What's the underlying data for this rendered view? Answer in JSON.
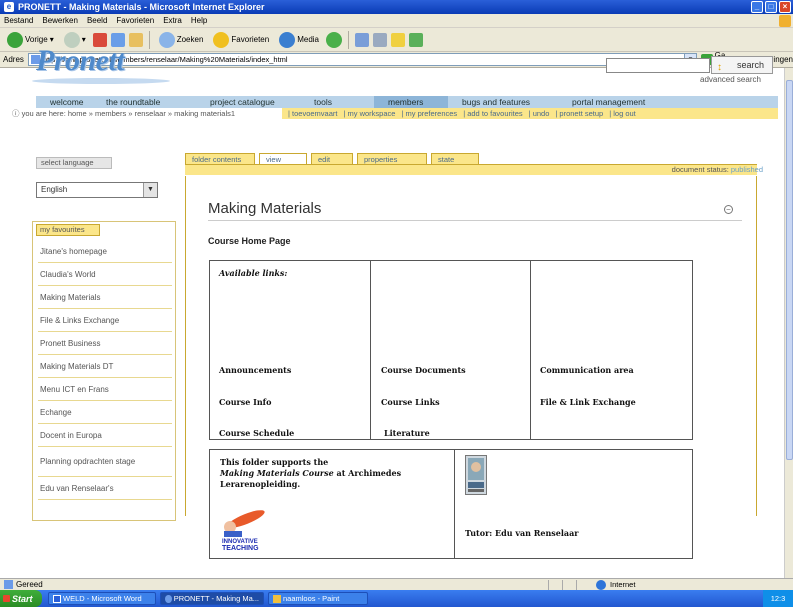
{
  "window": {
    "title": "PRONETT - Making Materials - Microsoft Internet Explorer"
  },
  "menubar": [
    "Bestand",
    "Bewerken",
    "Beeld",
    "Favorieten",
    "Extra",
    "Help"
  ],
  "toolbar": {
    "back": "Vorige",
    "search": "Zoeken",
    "favorites": "Favorieten",
    "media": "Media"
  },
  "address": {
    "label": "Adres",
    "url": "http://www.pronett.nl/Members/renselaar/Making%20Materials/index_html",
    "go": "Ga naar",
    "links": "Koppelingen"
  },
  "site": {
    "logo": "Pronett",
    "search_button": "search",
    "advanced_search": "advanced search"
  },
  "nav": {
    "items": [
      "welcome",
      "the roundtable",
      "project catalogue",
      "tools",
      "members",
      "bugs and features",
      "portal management"
    ],
    "subnav": [
      "| toevoemvaart",
      "| my workspace",
      "| my preferences",
      "| add to favourites",
      "| undo",
      "| pronett setup",
      "| log out"
    ],
    "breadcrumb": "you are here: home » members » renselaar » making materials1"
  },
  "sidebar": {
    "select_language_label": "select language",
    "language_value": "English",
    "favourites_label": "my favourites",
    "favourites": [
      "Jitane's homepage",
      "Claudia's World",
      "Making Materials",
      "File & Links Exchange",
      "Pronett Business",
      "Making Materials DT",
      "Menu ICT en Frans",
      "Echange",
      "Docent in Europa",
      "Planning opdrachten stage",
      "Edu van Renselaar's"
    ]
  },
  "tabs": [
    "folder contents",
    "view",
    "edit",
    "properties",
    "state"
  ],
  "document_status": {
    "label": "document status:",
    "value": "published"
  },
  "main": {
    "title": "Making Materials",
    "course_home": "Course Home Page",
    "available_links": "Available links:",
    "links": {
      "col1": [
        "Announcements",
        "Course Info",
        "Course Schedule"
      ],
      "col2": [
        "Course Documents",
        "Course Links",
        "Literature"
      ],
      "col3": [
        "Communication area",
        "File & Link Exchange"
      ]
    },
    "info": {
      "line1": "This folder supports the",
      "line2_italic": "Making Materials Course",
      "line2_rest": " at Archimedes",
      "line3": "Lerarenopleiding.",
      "image_text": "INNOVATIVE TEACHING",
      "tutor": "Tutor: Edu van Renselaar"
    }
  },
  "statusbar": {
    "left": "Gereed",
    "zone": "Internet"
  },
  "taskbar": {
    "start": "Start",
    "items": [
      "WELD - Microsoft Word",
      "PRONETT - Making Ma...",
      "naamloos - Paint"
    ],
    "clock": "12:3"
  }
}
